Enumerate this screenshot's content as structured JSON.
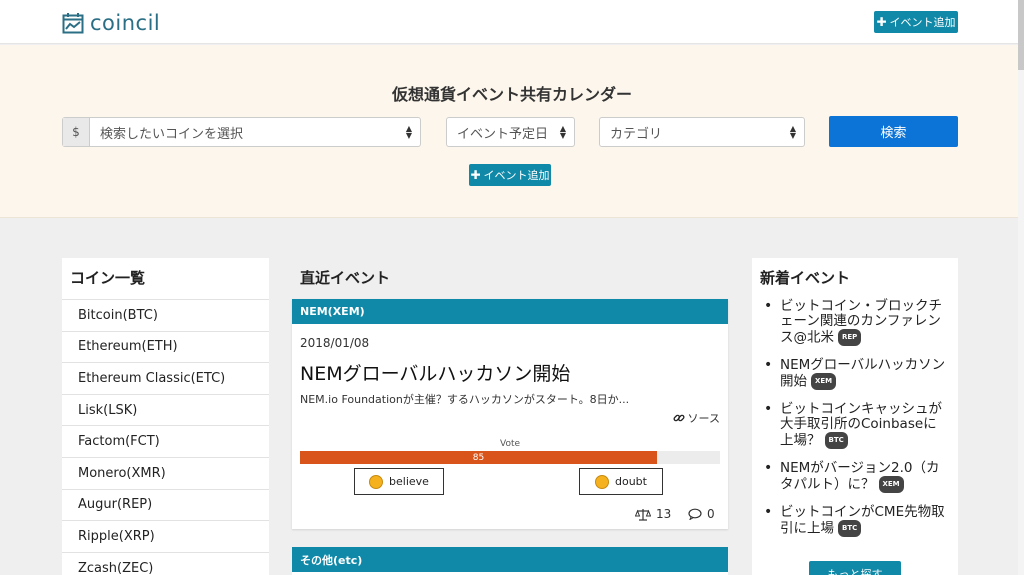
{
  "header": {
    "logo_text": "coincil",
    "add_event_label": "イベント追加"
  },
  "hero": {
    "title": "仮想通貨イベント共有カレンダー",
    "coin_select": {
      "prefix": "$",
      "placeholder": "検索したいコインを選択"
    },
    "date_select": {
      "value": "イベント予定日"
    },
    "category_select": {
      "value": "カテゴリ"
    },
    "search_label": "検索",
    "add_event_label": "イベント追加"
  },
  "coin_list": {
    "title": "コイン一覧",
    "items": [
      "Bitcoin(BTC)",
      "Ethereum(ETH)",
      "Ethereum Classic(ETC)",
      "Lisk(LSK)",
      "Factom(FCT)",
      "Monero(XMR)",
      "Augur(REP)",
      "Ripple(XRP)",
      "Zcash(ZEC)"
    ]
  },
  "recent_events": {
    "title": "直近イベント",
    "events": [
      {
        "coin": "NEM(XEM)",
        "date": "2018/01/08",
        "title": "NEMグローバルハッカソン開始",
        "description": "NEM.io Foundationが主催？するハッカソンがスタート。8日か...",
        "source_label": "ソース",
        "vote_label": "Vote",
        "vote_percent": 85,
        "believe_label": "believe",
        "doubt_label": "doubt",
        "scale_count": "13",
        "comment_count": "0"
      }
    ],
    "next_category": "その他(etc)"
  },
  "new_events": {
    "title": "新着イベント",
    "items": [
      {
        "text": "ビットコイン・ブロックチェーン関連のカンファレンス@北米",
        "badge": "REP"
      },
      {
        "text": "NEMグローバルハッカソン開始",
        "badge": "XEM"
      },
      {
        "text": "ビットコインキャッシュが大手取引所のCoinbaseに上場？",
        "badge": "BTC"
      },
      {
        "text": "NEMがバージョン2.0（カタパルト）に？",
        "badge": "XEM"
      },
      {
        "text": "ビットコインがCME先物取引に上場",
        "badge": "BTC"
      }
    ],
    "more_label": "もっと探す"
  },
  "colors": {
    "teal": "#1089a8",
    "search_blue": "#0c74d6",
    "vote_orange": "#d9541a",
    "hero_bg": "#fcf6ec"
  }
}
